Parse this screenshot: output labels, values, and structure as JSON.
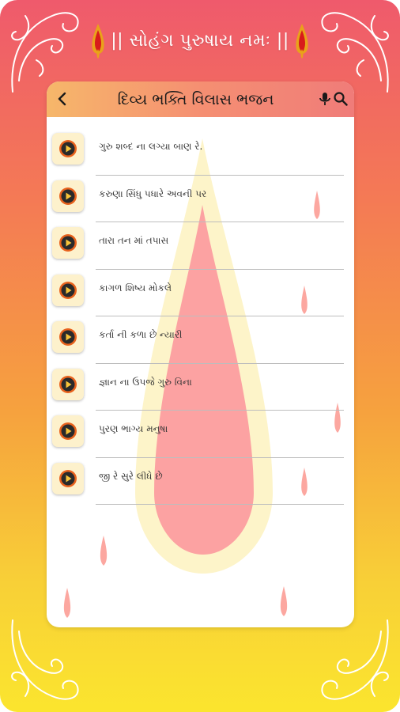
{
  "app": {
    "header_title": "|| સોહંગ પુરુષાય નમઃ ||"
  },
  "screen": {
    "title": "દિવ્ય ભક્તિ વિલાસ ભજન",
    "back_icon": "chevron-left-icon",
    "mic_icon": "microphone-icon",
    "search_icon": "search-icon"
  },
  "colors": {
    "header_gradient_start": "#f6b76a",
    "header_gradient_end": "#f07c79",
    "play_tile": "#fdf1cc",
    "play_ring": "#e8621d",
    "drop": "#fc9aa0"
  },
  "bhajans": [
    {
      "title": "ગુરુ શબ્દ ના લગ્યા બાણ રે."
    },
    {
      "title": "કરુણા સિંધુ પધારે અવની પર"
    },
    {
      "title": "તારા તન માં તપાસ"
    },
    {
      "title": "કાગળ શિષ્ય મોકલે"
    },
    {
      "title": "કર્તા ની કળા છે ન્યારી"
    },
    {
      "title": "જ્ઞાન ના ઉપજે ગુરુ વિના"
    },
    {
      "title": "પુરણ ભાગ્ય મનુષા"
    },
    {
      "title": "જી રે સુરે લીધે છે"
    }
  ]
}
